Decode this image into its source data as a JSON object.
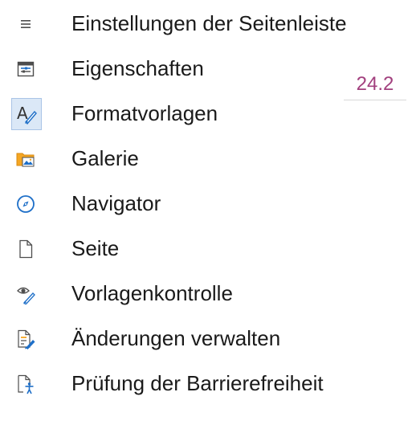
{
  "menu": {
    "items": [
      {
        "label": "Einstellungen der Seitenleiste",
        "icon": "hamburger-icon"
      },
      {
        "label": "Eigenschaften",
        "icon": "properties-icon"
      },
      {
        "label": "Formatvorlagen",
        "icon": "styles-icon"
      },
      {
        "label": "Galerie",
        "icon": "gallery-icon"
      },
      {
        "label": "Navigator",
        "icon": "navigator-icon"
      },
      {
        "label": "Seite",
        "icon": "page-icon"
      },
      {
        "label": "Vorlagenkontrolle",
        "icon": "style-inspector-icon"
      },
      {
        "label": "Änderungen verwalten",
        "icon": "manage-changes-icon"
      },
      {
        "label": "Prüfung der Barrierefreiheit",
        "icon": "accessibility-check-icon"
      }
    ],
    "selected_index": 2
  },
  "version_badge": "24.2",
  "colors": {
    "accent": "#a2407e",
    "selection_bg": "#dbe8f7",
    "selection_border": "#a9c4e6"
  }
}
